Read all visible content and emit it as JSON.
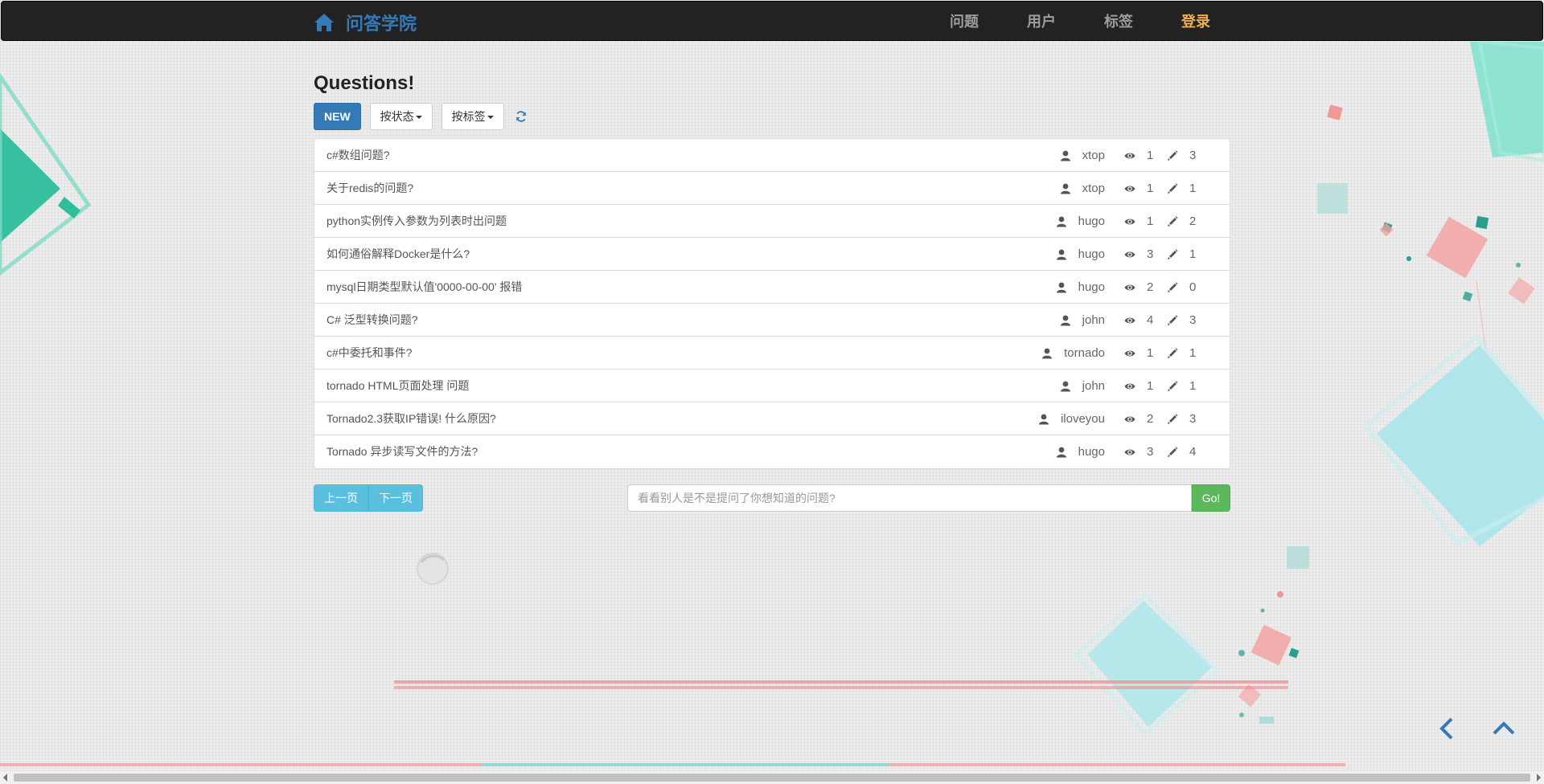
{
  "colors": {
    "navbar": "#222222",
    "brand": "#337ab7",
    "login": "#f0ad4e",
    "primary": "#337ab7",
    "info": "#5bc0de",
    "success": "#5cb85c"
  },
  "navbar": {
    "brand_icon": "home-icon",
    "brand_text": "问答学院",
    "links": [
      {
        "label": "问题"
      },
      {
        "label": "用户"
      },
      {
        "label": "标签"
      },
      {
        "label": "登录"
      }
    ]
  },
  "page": {
    "title": "Questions!"
  },
  "toolbar": {
    "new_label": "NEW",
    "status_filter_label": "按状态",
    "tag_filter_label": "按标签",
    "refresh_icon": "refresh-icon"
  },
  "questions": [
    {
      "title": "c#数组问题?",
      "author": "xtop",
      "views": "1",
      "answers": "3"
    },
    {
      "title": "关于redis的问题?",
      "author": "xtop",
      "views": "1",
      "answers": "1"
    },
    {
      "title": "python实例传入参数为列表时出问题",
      "author": "hugo",
      "views": "1",
      "answers": "2"
    },
    {
      "title": "如何通俗解释Docker是什么?",
      "author": "hugo",
      "views": "3",
      "answers": "1"
    },
    {
      "title": "mysql日期类型默认值'0000-00-00' 报错",
      "author": "hugo",
      "views": "2",
      "answers": "0"
    },
    {
      "title": "C# 泛型转换问题?",
      "author": "john",
      "views": "4",
      "answers": "3"
    },
    {
      "title": "c#中委托和事件?",
      "author": "tornado",
      "views": "1",
      "answers": "1"
    },
    {
      "title": "tornado HTML页面处理 问题",
      "author": "john",
      "views": "1",
      "answers": "1"
    },
    {
      "title": "Tornado2.3获取IP错误! 什么原因?",
      "author": "iloveyou",
      "views": "2",
      "answers": "3"
    },
    {
      "title": "Tornado 异步读写文件的方法?",
      "author": "hugo",
      "views": "3",
      "answers": "4"
    }
  ],
  "pager": {
    "prev_label": "上一页",
    "next_label": "下一页"
  },
  "search": {
    "placeholder": "看看别人是不是提问了你想知道的问题?",
    "value": "",
    "button_label": "Go!"
  },
  "corner": {
    "back_icon": "chevron-left-icon",
    "top_icon": "chevron-up-icon"
  }
}
